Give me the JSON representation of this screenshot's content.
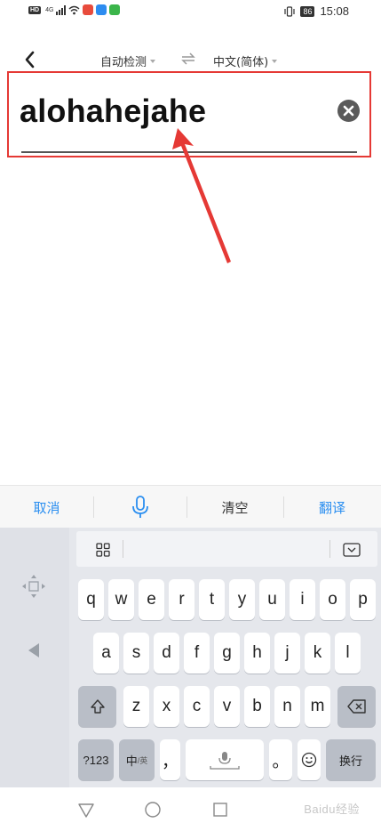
{
  "status": {
    "left_badge": "HD",
    "network": "4G",
    "battery": "86",
    "time": "15:08"
  },
  "nav": {
    "source_lang": "自动检测",
    "target_lang": "中文(简体)"
  },
  "input": {
    "value": "alohahejahe"
  },
  "colors": {
    "annotation_red": "#e53935",
    "accent_blue": "#2a8ef0",
    "key_fn": "#b9bec7"
  },
  "actions": {
    "cancel": "取消",
    "clear": "清空",
    "translate": "翻译"
  },
  "keyboard": {
    "row1": [
      "q",
      "w",
      "e",
      "r",
      "t",
      "y",
      "u",
      "i",
      "o",
      "p"
    ],
    "row2": [
      "a",
      "s",
      "d",
      "f",
      "g",
      "h",
      "j",
      "k",
      "l"
    ],
    "row3": [
      "z",
      "x",
      "c",
      "v",
      "b",
      "n",
      "m"
    ],
    "mode_123": "?123",
    "lang_switch": "中",
    "lang_switch_sub": "/英",
    "comma": "，",
    "period": "。",
    "enter": "换行"
  },
  "icons": {
    "back": "chevron-left-icon",
    "swap": "swap-arrows-icon",
    "clear_input": "close-circle-icon",
    "mic": "microphone-icon",
    "grid": "grid-icon",
    "collapse": "keyboard-collapse-icon",
    "shift": "shift-icon",
    "delete": "backspace-icon",
    "emoji": "emoji-icon",
    "space_mic": "microphone-icon",
    "cursor_move": "cursor-move-icon",
    "cursor_left": "triangle-left-icon",
    "nav_back": "triangle-back-icon",
    "nav_home": "circle-home-icon",
    "nav_recent": "square-recents-icon"
  },
  "watermark": "Baidu经验"
}
